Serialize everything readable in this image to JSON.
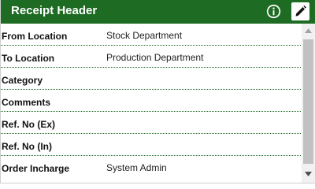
{
  "header": {
    "title": "Receipt Header",
    "info_icon": "info-circle-icon",
    "edit_icon": "pencil-edit-icon",
    "background_color": "#1e6b23"
  },
  "rows": [
    {
      "label": "From Location",
      "value": "Stock Department"
    },
    {
      "label": "To Location",
      "value": "Production Department"
    },
    {
      "label": "Category",
      "value": ""
    },
    {
      "label": "Comments",
      "value": ""
    },
    {
      "label": "Ref. No (Ex)",
      "value": ""
    },
    {
      "label": "Ref. No (In)",
      "value": ""
    },
    {
      "label": "Order Incharge",
      "value": "System Admin"
    }
  ],
  "scrollbar": {
    "up_icon": "scroll-up-arrow-icon",
    "down_icon": "scroll-down-arrow-icon"
  }
}
